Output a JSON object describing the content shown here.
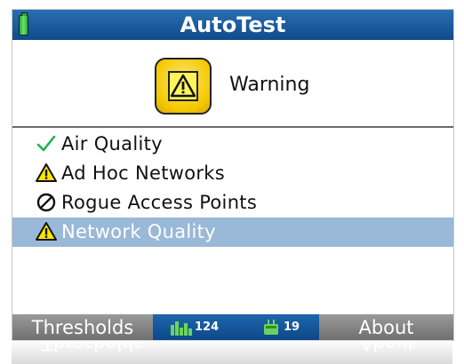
{
  "window": {
    "title": "AutoTest"
  },
  "status": {
    "text": "Warning",
    "icon": "warning-icon"
  },
  "tests": [
    {
      "label": "Air Quality",
      "icon": "checkmark-icon",
      "selected": false
    },
    {
      "label": "Ad Hoc Networks",
      "icon": "warning-icon",
      "selected": false
    },
    {
      "label": "Rogue Access Points",
      "icon": "prohibited-icon",
      "selected": false
    },
    {
      "label": "Network Quality",
      "icon": "warning-icon",
      "selected": true
    }
  ],
  "bottombar": {
    "left_label": "Thresholds",
    "right_label": "About",
    "signal_count": "124",
    "device_count": "19"
  },
  "colors": {
    "titlebar": "#0f4b8c",
    "selected_row": "#9ab8d7",
    "warning_yellow": "#f3c800",
    "check_green": "#22b14c",
    "bottombar_gray": "#7e7e7e"
  }
}
